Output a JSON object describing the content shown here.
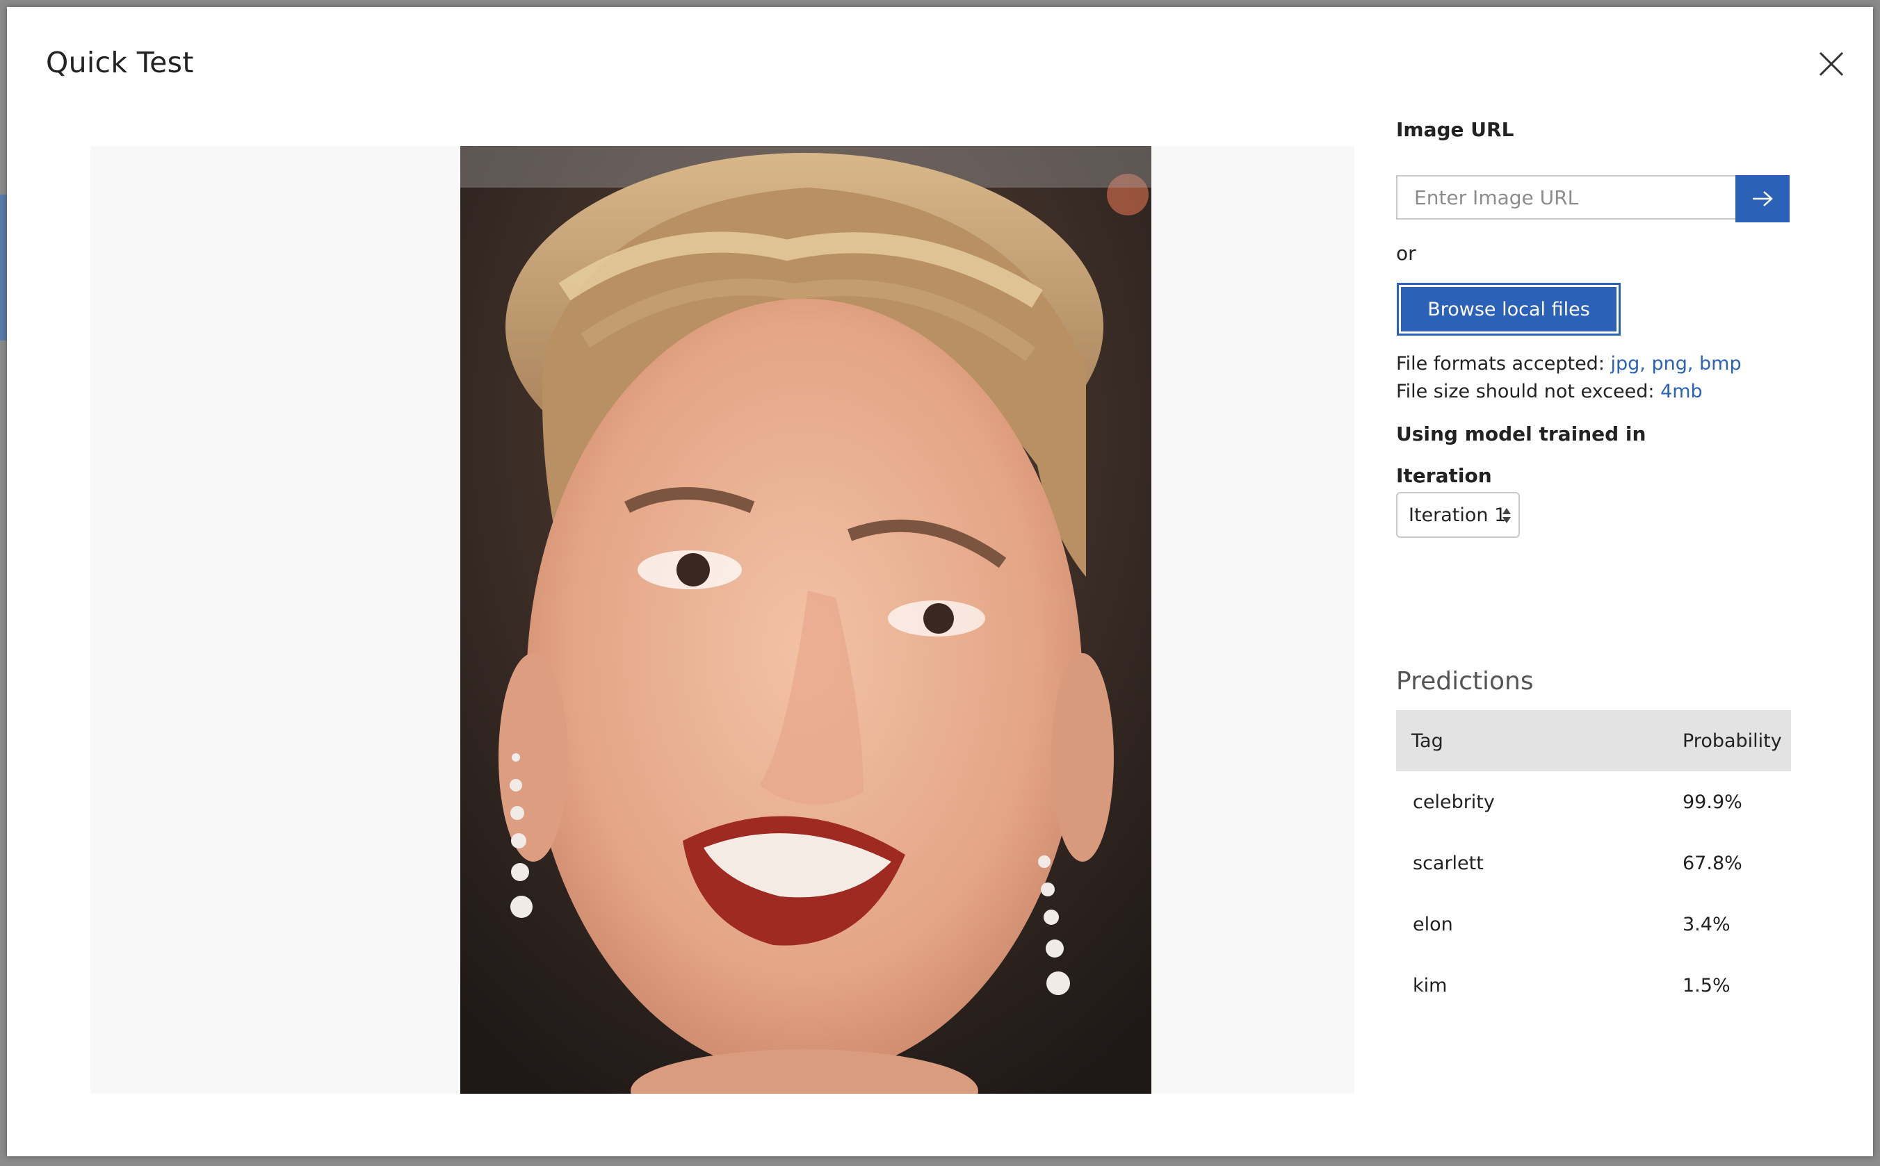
{
  "dialog": {
    "title": "Quick Test"
  },
  "image_url": {
    "label": "Image URL",
    "placeholder": "Enter Image URL",
    "go_icon": "arrow-right-icon"
  },
  "or_text": "or",
  "browse": {
    "label": "Browse local files"
  },
  "formats": {
    "accepted_label": "File formats accepted: ",
    "accepted_value": "jpg, png, bmp",
    "size_label": "File size should not exceed: ",
    "size_value": "4mb"
  },
  "model": {
    "label": "Using model trained in",
    "iteration_label": "Iteration",
    "iteration_selected": "Iteration 1"
  },
  "predictions": {
    "title": "Predictions",
    "columns": [
      "Tag",
      "Probability"
    ],
    "rows": [
      {
        "tag": "celebrity",
        "probability": "99.9%"
      },
      {
        "tag": "scarlett",
        "probability": "67.8%"
      },
      {
        "tag": "elon",
        "probability": "3.4%"
      },
      {
        "tag": "kim",
        "probability": "1.5%"
      }
    ]
  },
  "colors": {
    "accent": "#2b62b8",
    "table_header_bg": "#e3e3e3",
    "preview_bg": "#f8f8f8"
  }
}
